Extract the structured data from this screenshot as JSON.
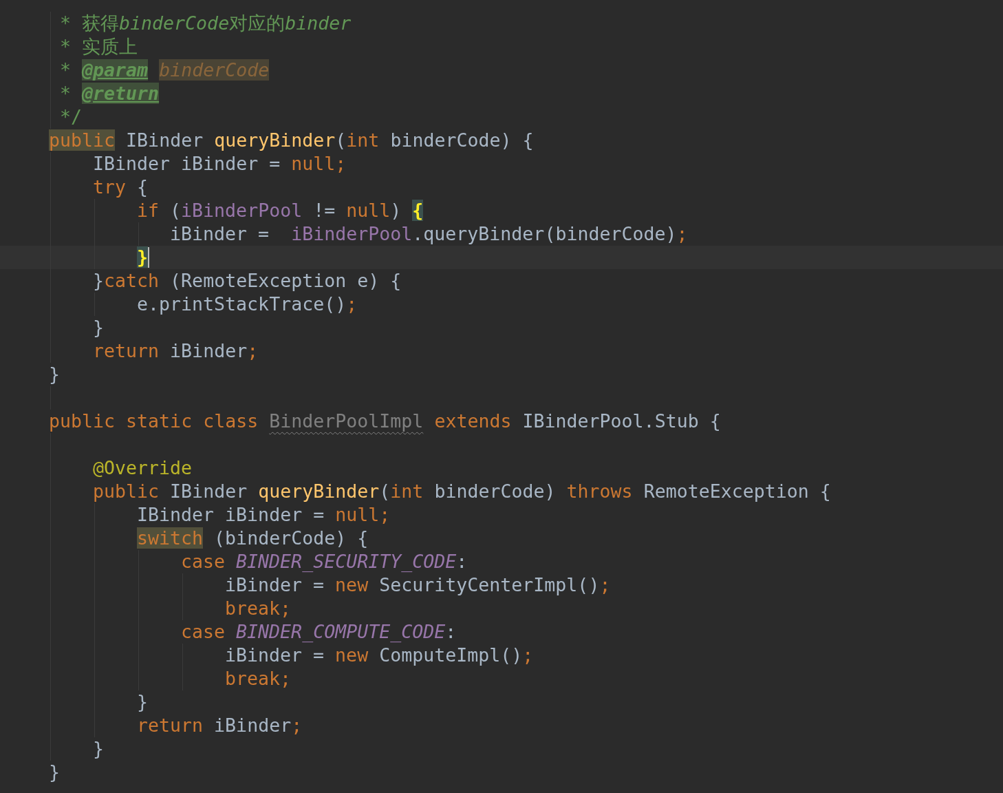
{
  "editor": {
    "lines": [
      {
        "current": false,
        "tokens": [
          {
            "text": "     * 获得",
            "kind": "doc"
          },
          {
            "text": "binderCode",
            "kind": "doc-code"
          },
          {
            "text": "对应的",
            "kind": "doc"
          },
          {
            "text": "binder",
            "kind": "doc-code"
          }
        ]
      },
      {
        "current": false,
        "tokens": [
          {
            "text": "     * 实质上",
            "kind": "doc"
          }
        ]
      },
      {
        "current": false,
        "tokens": [
          {
            "text": "     * ",
            "kind": "doc"
          },
          {
            "text": "@param",
            "kind": "doc-tag"
          },
          {
            "text": " binderCode",
            "kind": "doc-param"
          }
        ]
      },
      {
        "current": false,
        "tokens": [
          {
            "text": "     * ",
            "kind": "doc"
          },
          {
            "text": "@return",
            "kind": "doc-tag"
          }
        ]
      },
      {
        "current": false,
        "tokens": [
          {
            "text": "     */",
            "kind": "doc"
          }
        ]
      },
      {
        "current": false,
        "tokens": [
          {
            "text": "    public",
            "kind": "keyword-marked"
          },
          {
            "text": " IBinder ",
            "kind": "plain"
          },
          {
            "text": "queryBinder",
            "kind": "method"
          },
          {
            "text": "(",
            "kind": "plain"
          },
          {
            "text": "int",
            "kind": "keyword"
          },
          {
            "text": " binderCode) {",
            "kind": "plain"
          }
        ]
      },
      {
        "current": false,
        "tokens": [
          {
            "text": "        IBinder iBinder = ",
            "kind": "plain"
          },
          {
            "text": "null;",
            "kind": "keyword"
          }
        ]
      },
      {
        "current": false,
        "tokens": [
          {
            "text": "        try",
            "kind": "keyword"
          },
          {
            "text": " {",
            "kind": "plain"
          }
        ]
      },
      {
        "current": false,
        "tokens": [
          {
            "text": "            if",
            "kind": "keyword"
          },
          {
            "text": " (",
            "kind": "plain"
          },
          {
            "text": "iBinderPool",
            "kind": "field"
          },
          {
            "text": " != ",
            "kind": "plain"
          },
          {
            "text": "null",
            "kind": "keyword"
          },
          {
            "text": ") ",
            "kind": "plain"
          },
          {
            "text": "{",
            "kind": "brace-match"
          }
        ]
      },
      {
        "current": false,
        "tokens": [
          {
            "text": "               iBinder =  ",
            "kind": "plain"
          },
          {
            "text": "iBinderPool",
            "kind": "field"
          },
          {
            "text": ".queryBinder(binderCode)",
            "kind": "plain"
          },
          {
            "text": ";",
            "kind": "keyword"
          }
        ]
      },
      {
        "current": true,
        "tokens": [
          {
            "text": "            }",
            "kind": "brace-match"
          }
        ]
      },
      {
        "current": false,
        "tokens": [
          {
            "text": "        }",
            "kind": "plain"
          },
          {
            "text": "catch",
            "kind": "keyword"
          },
          {
            "text": " (RemoteException e) {",
            "kind": "plain"
          }
        ]
      },
      {
        "current": false,
        "tokens": [
          {
            "text": "            e.printStackTrace()",
            "kind": "plain"
          },
          {
            "text": ";",
            "kind": "keyword"
          }
        ]
      },
      {
        "current": false,
        "tokens": [
          {
            "text": "        }",
            "kind": "plain"
          }
        ]
      },
      {
        "current": false,
        "tokens": [
          {
            "text": "        return",
            "kind": "keyword"
          },
          {
            "text": " iBinder",
            "kind": "plain"
          },
          {
            "text": ";",
            "kind": "keyword"
          }
        ]
      },
      {
        "current": false,
        "tokens": [
          {
            "text": "    }",
            "kind": "plain"
          }
        ]
      },
      {
        "kind": "blank",
        "current": false
      },
      {
        "current": false,
        "tokens": [
          {
            "text": "    public static class",
            "kind": "keyword"
          },
          {
            "text": " BinderPoolImpl",
            "kind": "unused"
          },
          {
            "text": " extends",
            "kind": "keyword"
          },
          {
            "text": " IBinderPool.Stub {",
            "kind": "plain"
          }
        ]
      },
      {
        "kind": "blank",
        "current": false
      },
      {
        "current": false,
        "tokens": [
          {
            "text": "        @Override",
            "kind": "annotation"
          }
        ]
      },
      {
        "current": false,
        "tokens": [
          {
            "text": "        public",
            "kind": "keyword"
          },
          {
            "text": " IBinder ",
            "kind": "plain"
          },
          {
            "text": "queryBinder",
            "kind": "method"
          },
          {
            "text": "(",
            "kind": "plain"
          },
          {
            "text": "int",
            "kind": "keyword"
          },
          {
            "text": " binderCode) ",
            "kind": "plain"
          },
          {
            "text": "throws",
            "kind": "keyword"
          },
          {
            "text": " RemoteException {",
            "kind": "plain"
          }
        ]
      },
      {
        "current": false,
        "tokens": [
          {
            "text": "            IBinder iBinder = ",
            "kind": "plain"
          },
          {
            "text": "null;",
            "kind": "keyword"
          }
        ]
      },
      {
        "current": false,
        "tokens": [
          {
            "text": "            switch",
            "kind": "keyword-marked"
          },
          {
            "text": " (binderCode) {",
            "kind": "plain"
          }
        ]
      },
      {
        "current": false,
        "tokens": [
          {
            "text": "                case",
            "kind": "keyword"
          },
          {
            "text": " BINDER_SECURITY_CODE",
            "kind": "constant"
          },
          {
            "text": ":",
            "kind": "plain"
          }
        ]
      },
      {
        "current": false,
        "tokens": [
          {
            "text": "                    iBinder = ",
            "kind": "plain"
          },
          {
            "text": "new",
            "kind": "keyword"
          },
          {
            "text": " SecurityCenterImpl()",
            "kind": "plain"
          },
          {
            "text": ";",
            "kind": "keyword"
          }
        ]
      },
      {
        "current": false,
        "tokens": [
          {
            "text": "                    break;",
            "kind": "keyword"
          }
        ]
      },
      {
        "current": false,
        "tokens": [
          {
            "text": "                case",
            "kind": "keyword"
          },
          {
            "text": " BINDER_COMPUTE_CODE",
            "kind": "constant"
          },
          {
            "text": ":",
            "kind": "plain"
          }
        ]
      },
      {
        "current": false,
        "tokens": [
          {
            "text": "                    iBinder = ",
            "kind": "plain"
          },
          {
            "text": "new",
            "kind": "keyword"
          },
          {
            "text": " ComputeImpl()",
            "kind": "plain"
          },
          {
            "text": ";",
            "kind": "keyword"
          }
        ]
      },
      {
        "current": false,
        "tokens": [
          {
            "text": "                    break;",
            "kind": "keyword"
          }
        ]
      },
      {
        "current": false,
        "tokens": [
          {
            "text": "            }",
            "kind": "plain"
          }
        ]
      },
      {
        "current": false,
        "tokens": [
          {
            "text": "            return",
            "kind": "keyword"
          },
          {
            "text": " iBinder",
            "kind": "plain"
          },
          {
            "text": ";",
            "kind": "keyword"
          }
        ]
      },
      {
        "current": false,
        "tokens": [
          {
            "text": "        }",
            "kind": "plain"
          }
        ]
      },
      {
        "current": false,
        "tokens": [
          {
            "text": "    }",
            "kind": "plain"
          }
        ]
      }
    ]
  }
}
